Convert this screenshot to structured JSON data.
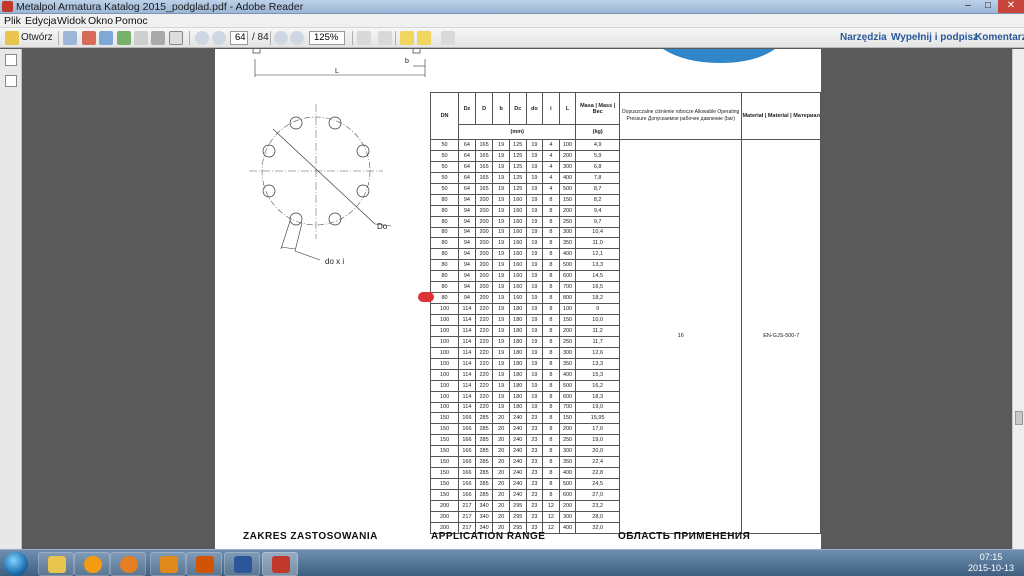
{
  "window": {
    "title": "Metalpol Armatura Katalog 2015_podglad.pdf - Adobe Reader",
    "min": "–",
    "max": "□",
    "close": "✕"
  },
  "menu": [
    "Plik",
    "Edycja",
    "Widok",
    "Okno",
    "Pomoc"
  ],
  "toolbar": {
    "open_label": "Otwórz",
    "page_current": "64",
    "page_total": "/ 84",
    "zoom": "125%",
    "right": [
      "Narzędzia",
      "Wypełnij i podpisz",
      "Komentarz"
    ]
  },
  "document": {
    "drawing_labels": {
      "b": "b",
      "L": "L",
      "Do": "Do",
      "doxi": "do x i"
    },
    "headers": {
      "dn": "DN",
      "dz": "Dz",
      "d": "D",
      "b": "b",
      "dc": "Dc",
      "do": "do",
      "i": "i",
      "l": "L",
      "masa": "Masa | Mass | Вес",
      "mm": "(mm)",
      "kg": "(kg)",
      "pressure": "Dopuszczalne ciśnienie robocze Allowable Operating Pressure Допускаемое рабочее давление (bar)",
      "material": "Materiał | Material | Материал"
    },
    "pressure_value": "16",
    "material_value": "EN-GJS-500-7",
    "rows": [
      [
        "50",
        "64",
        "165",
        "19",
        "125",
        "19",
        "4",
        "100",
        "4,9"
      ],
      [
        "50",
        "64",
        "165",
        "19",
        "125",
        "19",
        "4",
        "200",
        "5,9"
      ],
      [
        "50",
        "64",
        "165",
        "19",
        "125",
        "19",
        "4",
        "300",
        "6,8"
      ],
      [
        "50",
        "64",
        "165",
        "19",
        "125",
        "19",
        "4",
        "400",
        "7,8"
      ],
      [
        "50",
        "64",
        "165",
        "19",
        "125",
        "19",
        "4",
        "500",
        "8,7"
      ],
      [
        "80",
        "94",
        "200",
        "19",
        "160",
        "19",
        "8",
        "150",
        "8,2"
      ],
      [
        "80",
        "94",
        "200",
        "19",
        "160",
        "19",
        "8",
        "200",
        "9,4"
      ],
      [
        "80",
        "94",
        "200",
        "19",
        "160",
        "19",
        "8",
        "250",
        "9,7"
      ],
      [
        "80",
        "94",
        "200",
        "19",
        "160",
        "19",
        "8",
        "300",
        "10,4"
      ],
      [
        "80",
        "94",
        "200",
        "19",
        "160",
        "19",
        "8",
        "350",
        "11,0"
      ],
      [
        "80",
        "94",
        "200",
        "19",
        "160",
        "19",
        "8",
        "400",
        "12,1"
      ],
      [
        "80",
        "94",
        "200",
        "19",
        "160",
        "19",
        "8",
        "500",
        "13,3"
      ],
      [
        "80",
        "94",
        "200",
        "19",
        "160",
        "19",
        "8",
        "600",
        "14,5"
      ],
      [
        "80",
        "94",
        "200",
        "19",
        "160",
        "19",
        "8",
        "700",
        "16,5"
      ],
      [
        "80",
        "94",
        "200",
        "19",
        "160",
        "19",
        "8",
        "800",
        "18,2"
      ],
      [
        "100",
        "114",
        "220",
        "19",
        "180",
        "19",
        "8",
        "100",
        "9"
      ],
      [
        "100",
        "114",
        "220",
        "19",
        "180",
        "19",
        "8",
        "150",
        "10,0"
      ],
      [
        "100",
        "114",
        "220",
        "19",
        "180",
        "19",
        "8",
        "200",
        "11,2"
      ],
      [
        "100",
        "114",
        "220",
        "19",
        "180",
        "19",
        "8",
        "250",
        "11,7"
      ],
      [
        "100",
        "114",
        "220",
        "19",
        "180",
        "19",
        "8",
        "300",
        "12,6"
      ],
      [
        "100",
        "114",
        "220",
        "19",
        "180",
        "19",
        "8",
        "350",
        "13,3"
      ],
      [
        "100",
        "114",
        "220",
        "19",
        "180",
        "19",
        "8",
        "400",
        "15,3"
      ],
      [
        "100",
        "114",
        "220",
        "19",
        "180",
        "19",
        "8",
        "500",
        "16,2"
      ],
      [
        "100",
        "114",
        "220",
        "19",
        "180",
        "19",
        "8",
        "600",
        "18,3"
      ],
      [
        "100",
        "114",
        "220",
        "19",
        "180",
        "19",
        "8",
        "700",
        "19,0"
      ],
      [
        "150",
        "166",
        "285",
        "20",
        "240",
        "23",
        "8",
        "150",
        "15,95"
      ],
      [
        "150",
        "166",
        "285",
        "20",
        "240",
        "23",
        "8",
        "200",
        "17,6"
      ],
      [
        "150",
        "166",
        "285",
        "20",
        "240",
        "23",
        "8",
        "250",
        "19,0"
      ],
      [
        "150",
        "166",
        "285",
        "20",
        "240",
        "23",
        "8",
        "300",
        "20,0"
      ],
      [
        "150",
        "166",
        "285",
        "20",
        "240",
        "23",
        "8",
        "350",
        "22,4"
      ],
      [
        "150",
        "166",
        "285",
        "20",
        "240",
        "23",
        "8",
        "400",
        "22,8"
      ],
      [
        "150",
        "166",
        "285",
        "20",
        "240",
        "23",
        "8",
        "500",
        "24,5"
      ],
      [
        "150",
        "166",
        "285",
        "20",
        "240",
        "23",
        "8",
        "600",
        "27,0"
      ],
      [
        "200",
        "217",
        "340",
        "20",
        "295",
        "23",
        "12",
        "200",
        "23,2"
      ],
      [
        "200",
        "217",
        "340",
        "20",
        "295",
        "23",
        "12",
        "300",
        "28,0"
      ],
      [
        "200",
        "217",
        "340",
        "20",
        "295",
        "23",
        "12",
        "400",
        "32,0"
      ]
    ],
    "sections": [
      "ZAKRES ZASTOSOWANIA",
      "APPLICATION RANGE",
      "ОБЛАСТЬ ПРИМЕНЕНИЯ"
    ]
  },
  "taskbar": {
    "time": "07:15",
    "date": "2015-10-13"
  }
}
